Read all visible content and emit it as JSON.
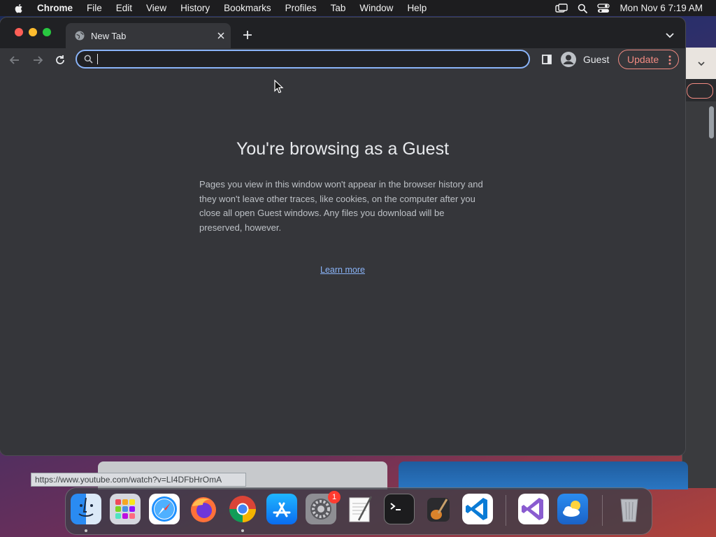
{
  "menubar": {
    "app_name": "Chrome",
    "menus": [
      "File",
      "Edit",
      "View",
      "History",
      "Bookmarks",
      "Profiles",
      "Tab",
      "Window",
      "Help"
    ],
    "clock": "Mon Nov 6  7:19 AM"
  },
  "browser": {
    "tab_title": "New Tab",
    "omnibox": {
      "value": "",
      "placeholder": ""
    },
    "profile_name": "Guest",
    "update_label": "Update"
  },
  "page": {
    "heading": "You're browsing as a Guest",
    "body": "Pages you view in this window won't appear in the browser history and they won't leave other traces, like cookies, on the computer after you close all open Guest windows. Any files you download will be preserved, however.",
    "link": "Learn more"
  },
  "status_url": "https://www.youtube.com/watch?v=LI4DFbHrOmA",
  "dock": {
    "items": [
      {
        "icon": "finder-icon",
        "running": true
      },
      {
        "icon": "launchpad-icon",
        "running": false
      },
      {
        "icon": "safari-icon",
        "running": false
      },
      {
        "icon": "firefox-icon",
        "running": false
      },
      {
        "icon": "chrome-icon",
        "running": true
      },
      {
        "icon": "app-store-icon",
        "running": false
      },
      {
        "icon": "system-settings-icon",
        "running": false,
        "badge": "1"
      },
      {
        "icon": "textedit-icon",
        "running": false
      },
      {
        "icon": "terminal-icon",
        "running": false
      },
      {
        "icon": "garageband-icon",
        "running": false
      },
      {
        "icon": "vscode-icon",
        "running": false
      },
      {
        "icon": "visual-studio-icon",
        "running": false
      },
      {
        "icon": "weather-icon",
        "running": false
      },
      {
        "icon": "trash-icon",
        "running": false
      }
    ]
  },
  "colors": {
    "accent_blue": "#8ab4f8",
    "update_red": "#f28b82",
    "window_bg": "#35363a",
    "tabstrip_bg": "#202124"
  }
}
